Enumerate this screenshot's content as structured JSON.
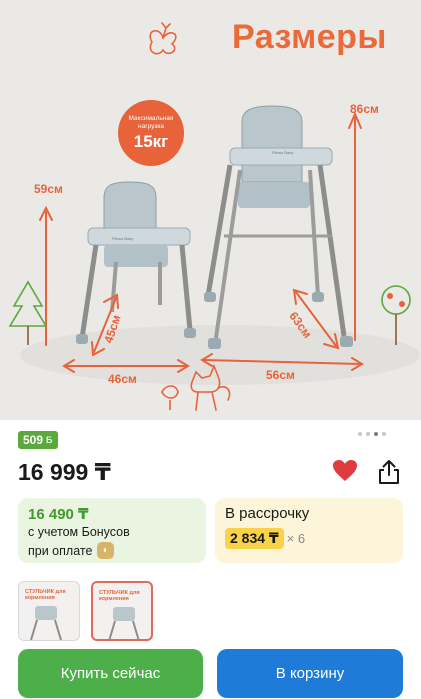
{
  "hero": {
    "title": "Размеры",
    "badge_small": "Максимальная нагрузка",
    "badge_big": "15кг",
    "brand_small": "Pituso Baby",
    "brand_large": "Pituso Baby",
    "dims": {
      "small_height": "59см",
      "small_depth": "45см",
      "small_width": "46см",
      "large_height": "86см",
      "large_depth": "63см",
      "large_width": "56см"
    }
  },
  "gallery": {
    "dots_total": 4,
    "active_index": 2
  },
  "product": {
    "bonus_value": "509",
    "bonus_symbol": "Б",
    "price": "16 999 ₸"
  },
  "bonus_card": {
    "price": "16 490 ₸",
    "line1": "с учетом Бонусов",
    "line2": "при оплате"
  },
  "installment_card": {
    "title": "В рассрочку",
    "amount": "2 834 ₸",
    "multiplier": "× 6"
  },
  "thumbnails": [
    {
      "label": "СТУЛЬЧИК для кормления"
    },
    {
      "label": "СТУЛЬЧИК для кормления"
    }
  ],
  "actions": {
    "buy_now": "Купить сейчас",
    "add_to_cart": "В корзину"
  },
  "colors": {
    "accent_orange": "#e8633a",
    "green": "#4daf4a",
    "blue": "#1f7bd8",
    "heart": "#e0393e",
    "installment_chip": "#fad249"
  },
  "icons": [
    "heart-icon",
    "share-icon",
    "bonus-coin-icon",
    "butterfly-icon",
    "tree-icon",
    "cat-icon",
    "bird-icon"
  ]
}
